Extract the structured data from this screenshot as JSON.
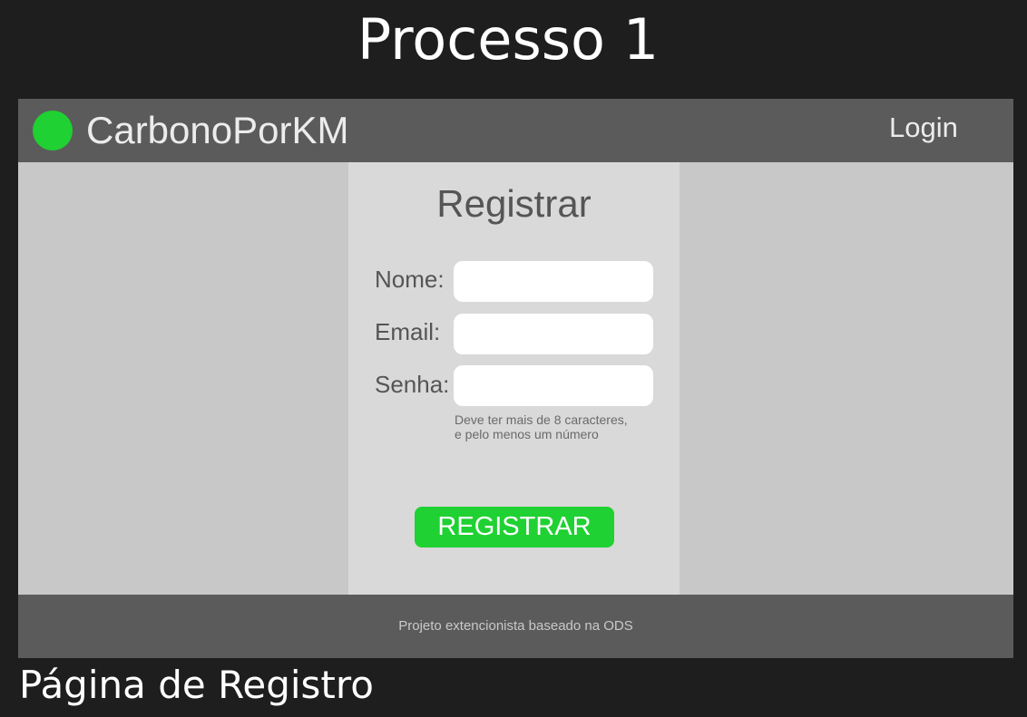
{
  "canvas": {
    "title": "Processo 1",
    "caption": "Página de Registro"
  },
  "navbar": {
    "logo_icon": "green-circle-logo",
    "brand": "CarbonoPorKM",
    "login_label": "Login"
  },
  "register_form": {
    "title": "Registrar",
    "fields": [
      {
        "label": "Nome:",
        "value": "",
        "placeholder": ""
      },
      {
        "label": "Email:",
        "value": "",
        "placeholder": ""
      },
      {
        "label": "Senha:",
        "value": "",
        "placeholder": ""
      }
    ],
    "password_hint_line1": "Deve ter mais de 8 caracteres,",
    "password_hint_line2": "e pelo menos um número",
    "submit_label": "REGISTRAR"
  },
  "footer": {
    "text": "Projeto extencionista baseado na ODS"
  },
  "colors": {
    "background": "#1e1e1e",
    "bar": "#5b5b5b",
    "page": "#c8c8c8",
    "panel": "#d9d9d9",
    "accent": "#1fd132"
  }
}
